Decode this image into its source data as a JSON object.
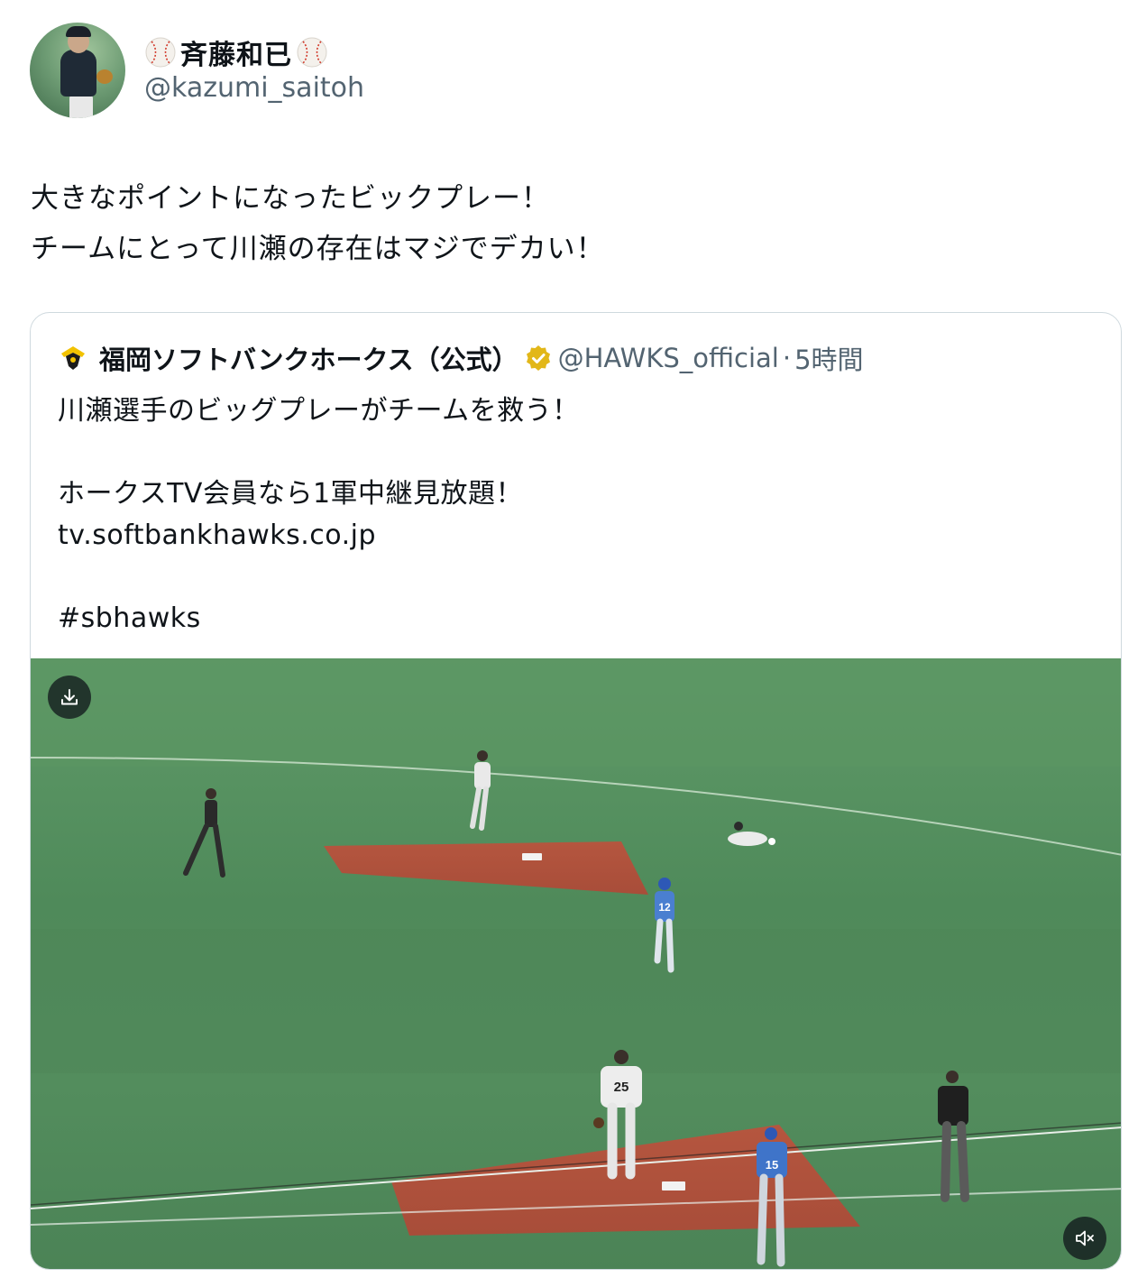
{
  "author": {
    "display_name": "斉藤和已",
    "handle": "@kazumi_saitoh",
    "avatar_icon": "pitcher-avatar",
    "name_decoration_icon": "baseball-icon"
  },
  "tweet": {
    "lines": [
      "大きなポイントになったビックプレー！",
      "チームにとって川瀬の存在はマジでデカい！"
    ]
  },
  "quote": {
    "account_name": "福岡ソフトバンクホークス（公式）",
    "handle": "@HAWKS_official",
    "separator": "·",
    "time": "5時間",
    "verified_color": "#e2b719",
    "body_lines": [
      "川瀬選手のビッグプレーがチームを救う！",
      "",
      "ホークスTV会員なら1軍中継見放題！",
      "tv.softbankhawks.co.jp",
      "",
      "#sbhawks"
    ],
    "video": {
      "download_icon": "download-icon",
      "mute_icon": "muted-speaker-icon",
      "jersey_numbers": [
        "12",
        "25",
        "15"
      ]
    }
  }
}
